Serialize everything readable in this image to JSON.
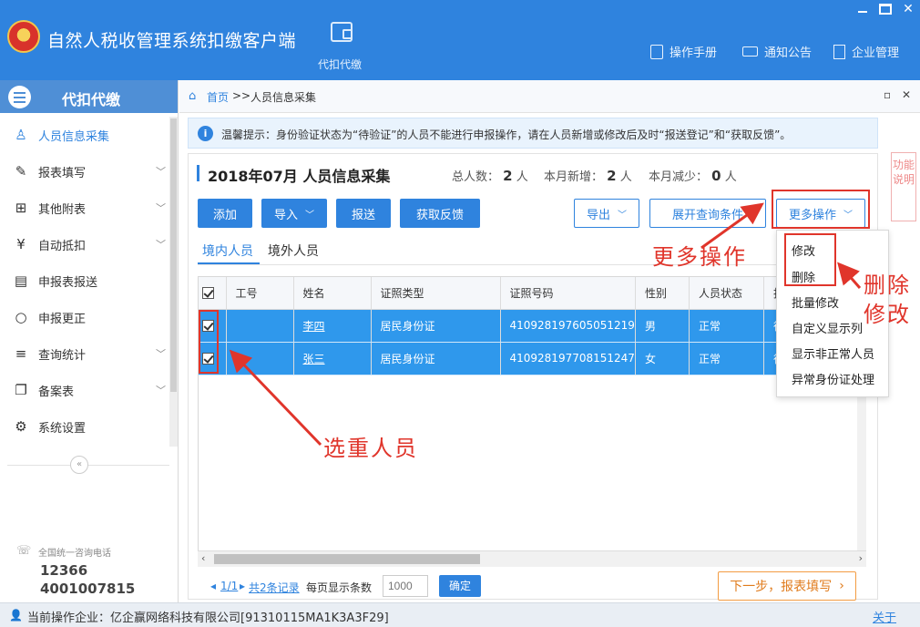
{
  "app": {
    "title": "自然人税收管理系统扣缴客户端",
    "module": "代扣代缴",
    "links": [
      "操作手册",
      "通知公告",
      "企业管理"
    ]
  },
  "sidebar": {
    "header": "代扣代缴",
    "items": [
      {
        "label": "人员信息采集",
        "icon": "person-icon"
      },
      {
        "label": "报表填写",
        "icon": "edit-icon"
      },
      {
        "label": "其他附表",
        "icon": "grid-icon"
      },
      {
        "label": "自动抵扣",
        "icon": "yen-coin-icon"
      },
      {
        "label": "申报表报送",
        "icon": "form-send-icon"
      },
      {
        "label": "申报更正",
        "icon": "search-correct-icon"
      },
      {
        "label": "查询统计",
        "icon": "query-list-icon"
      },
      {
        "label": "备案表",
        "icon": "copy-icon"
      },
      {
        "label": "系统设置",
        "icon": "gear-icon"
      }
    ],
    "hotline_label": "全国统一咨询电话",
    "hotline_1": "12366",
    "hotline_2": "4001007815"
  },
  "breadcrumb": {
    "home": "首页",
    "separator": ">>",
    "current": "人员信息采集"
  },
  "notice": "温馨提示：身份验证状态为“待验证”的人员不能进行申报操作，请在人员新增或修改后及时“报送登记”和“获取反馈”。",
  "help_tab": "功能说明",
  "period": {
    "title": "2018年07月  人员信息采集",
    "total_label": "总人数：",
    "total": "2",
    "total_unit": "人",
    "added_label": "本月新增：",
    "added": "2",
    "added_unit": "人",
    "removed_label": "本月减少：",
    "removed": "0",
    "removed_unit": "人"
  },
  "toolbar": {
    "add": "添加",
    "import": "导入",
    "submit": "报送",
    "feedback": "获取反馈",
    "export": "导出",
    "expand": "展开查询条件",
    "more": "更多操作"
  },
  "tabs": {
    "domestic": "境内人员",
    "foreign": "境外人员"
  },
  "table": {
    "headers": [
      "工号",
      "姓名",
      "证照类型",
      "证照号码",
      "性别",
      "人员状态",
      "报"
    ],
    "rows": [
      {
        "id": "",
        "name": "李四",
        "doc_type": "居民身份证",
        "doc_no": "410928197605051219",
        "gender": "男",
        "status": "正常",
        "extra": "待"
      },
      {
        "id": "",
        "name": "张三",
        "doc_type": "居民身份证",
        "doc_no": "410928197708151247",
        "gender": "女",
        "status": "正常",
        "extra": "待"
      }
    ]
  },
  "pager": {
    "page": "1/1",
    "records": "共2条记录",
    "per_page_label": "每页显示条数",
    "per_page_placeholder": "1000",
    "confirm": "确定",
    "next": "下一步，报表填写"
  },
  "dropdown": [
    "修改",
    "删除",
    "批量修改",
    "自定义显示列",
    "显示非正常人员",
    "异常身份证处理"
  ],
  "annotations": {
    "more_ops": "更多操作",
    "delete": "删除",
    "modify": "修改",
    "select": "选重人员"
  },
  "status": {
    "label": "当前操作企业：",
    "company": "亿企赢网络科技有限公司[91310115MA1K3A3F29]",
    "about": "关于"
  },
  "colors": {
    "brand": "#2f83de",
    "selected_row": "#2f98ec",
    "annotation": "#e0352b",
    "next_button": "#f39c42"
  }
}
